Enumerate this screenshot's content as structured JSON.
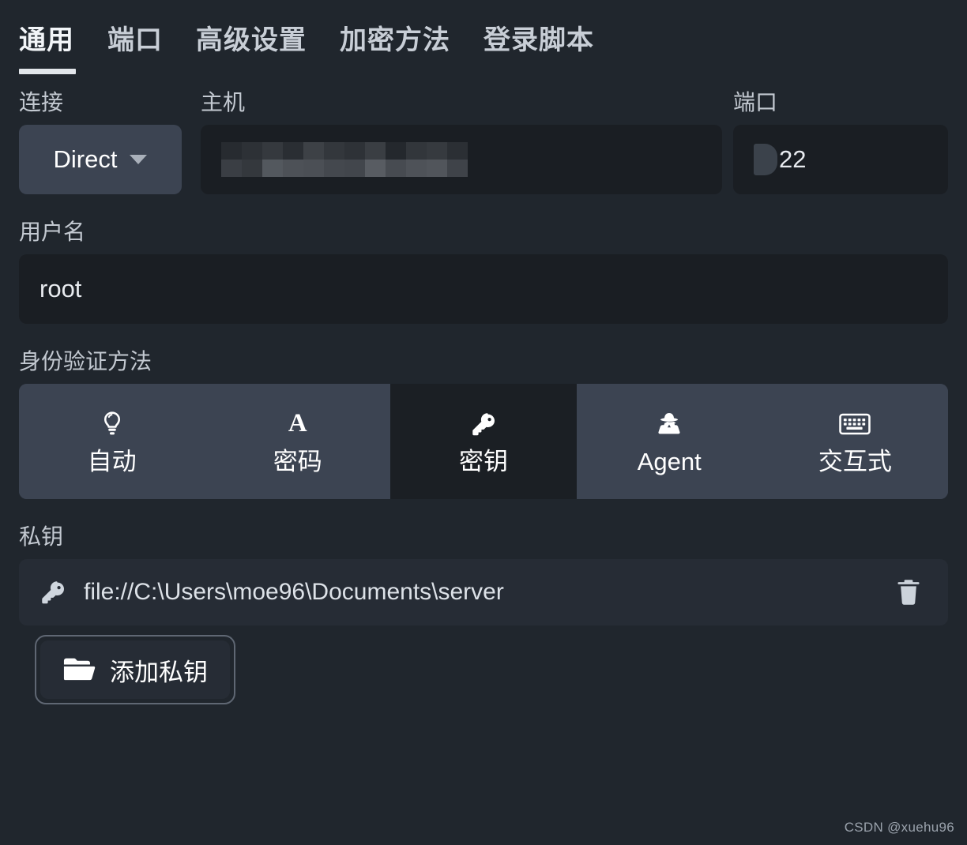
{
  "tabs": [
    {
      "label": "通用",
      "active": true
    },
    {
      "label": "端口",
      "active": false
    },
    {
      "label": "高级设置",
      "active": false
    },
    {
      "label": "加密方法",
      "active": false
    },
    {
      "label": "登录脚本",
      "active": false
    }
  ],
  "connection": {
    "label": "连接",
    "selected": "Direct",
    "icon": "chevron-down-icon"
  },
  "host": {
    "label": "主机",
    "value": "",
    "censored": true,
    "placeholder": ""
  },
  "port": {
    "label": "端口",
    "value": "22",
    "censored_prefix": true,
    "placeholder": ""
  },
  "username": {
    "label": "用户名",
    "value": "root",
    "placeholder": ""
  },
  "auth": {
    "label": "身份验证方法",
    "options": [
      {
        "label": "自动",
        "icon": "lightbulb-icon",
        "selected": false
      },
      {
        "label": "密码",
        "icon": "letter-a-icon",
        "selected": false
      },
      {
        "label": "密钥",
        "icon": "key-icon",
        "selected": true
      },
      {
        "label": "Agent",
        "icon": "spy-icon",
        "selected": false
      },
      {
        "label": "交互式",
        "icon": "keyboard-icon",
        "selected": false
      }
    ]
  },
  "private_key": {
    "label": "私钥",
    "entries": [
      {
        "icon": "key-icon",
        "path": "file://C:\\Users\\moe96\\Documents\\server",
        "delete_icon": "trash-icon"
      }
    ],
    "add_button": {
      "label": "添加私钥",
      "icon": "folder-open-icon"
    }
  },
  "watermark": "CSDN @xuehu96",
  "colors": {
    "page_bg": "#20262d",
    "input_bg": "#1a1e23",
    "segment_bg": "#3c4452",
    "segment_selected_bg": "#1b1f24",
    "row_bg": "#262c35",
    "text": "#e6eaee",
    "tab_underline": "#e2e6ea"
  }
}
